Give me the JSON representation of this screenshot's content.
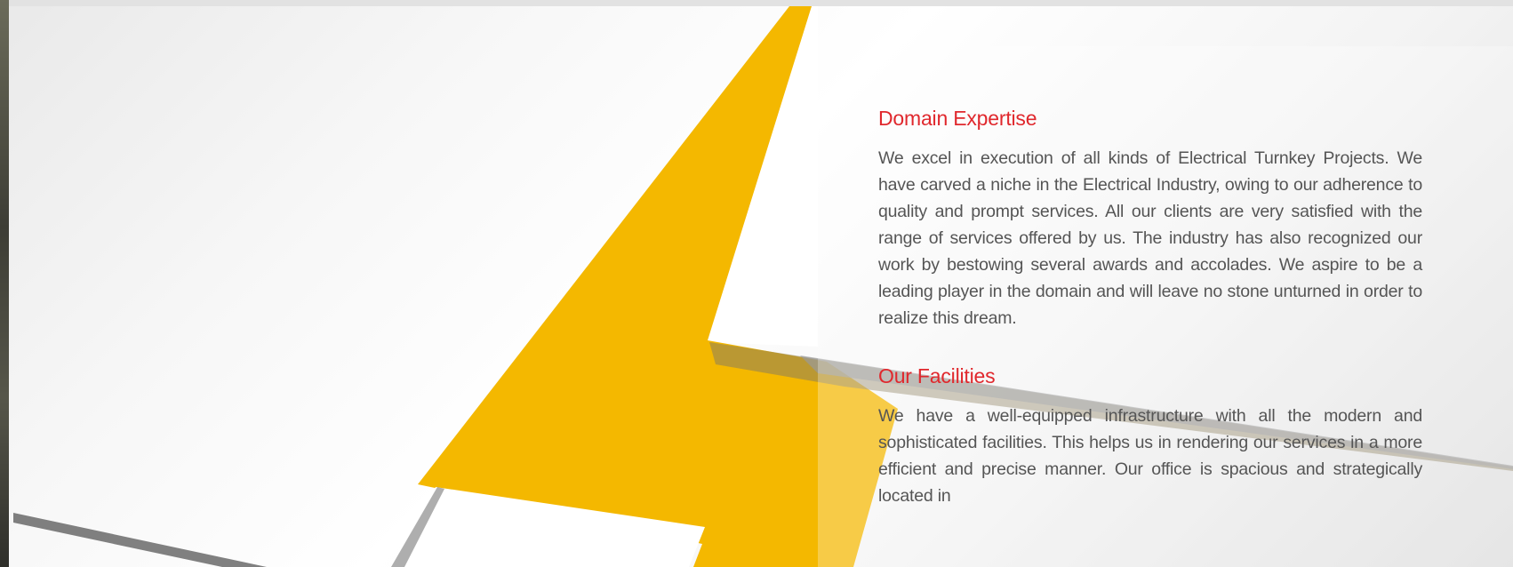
{
  "sections": [
    {
      "title": "Domain Expertise",
      "body": "We excel in execution of all kinds of Electrical Turnkey Projects. We have carved a niche in the Electrical Industry, owing to our adherence to quality and prompt services. All our clients are very satisfied with the range of services offered by us. The industry has also recognized our work by bestowing several awards and accolades. We aspire to be a leading player in the domain and will leave no stone unturned in order to realize this dream."
    },
    {
      "title": "Our Facilities",
      "body": "We have a well-equipped infrastructure with all the modern and sophisticated facilities. This helps us in rendering our services in a more efficient and precise manner. Our office is spacious and strategically located in"
    }
  ],
  "colors": {
    "heading": "#e0282d",
    "bolt": "#f4b800",
    "body_text": "#555555"
  }
}
